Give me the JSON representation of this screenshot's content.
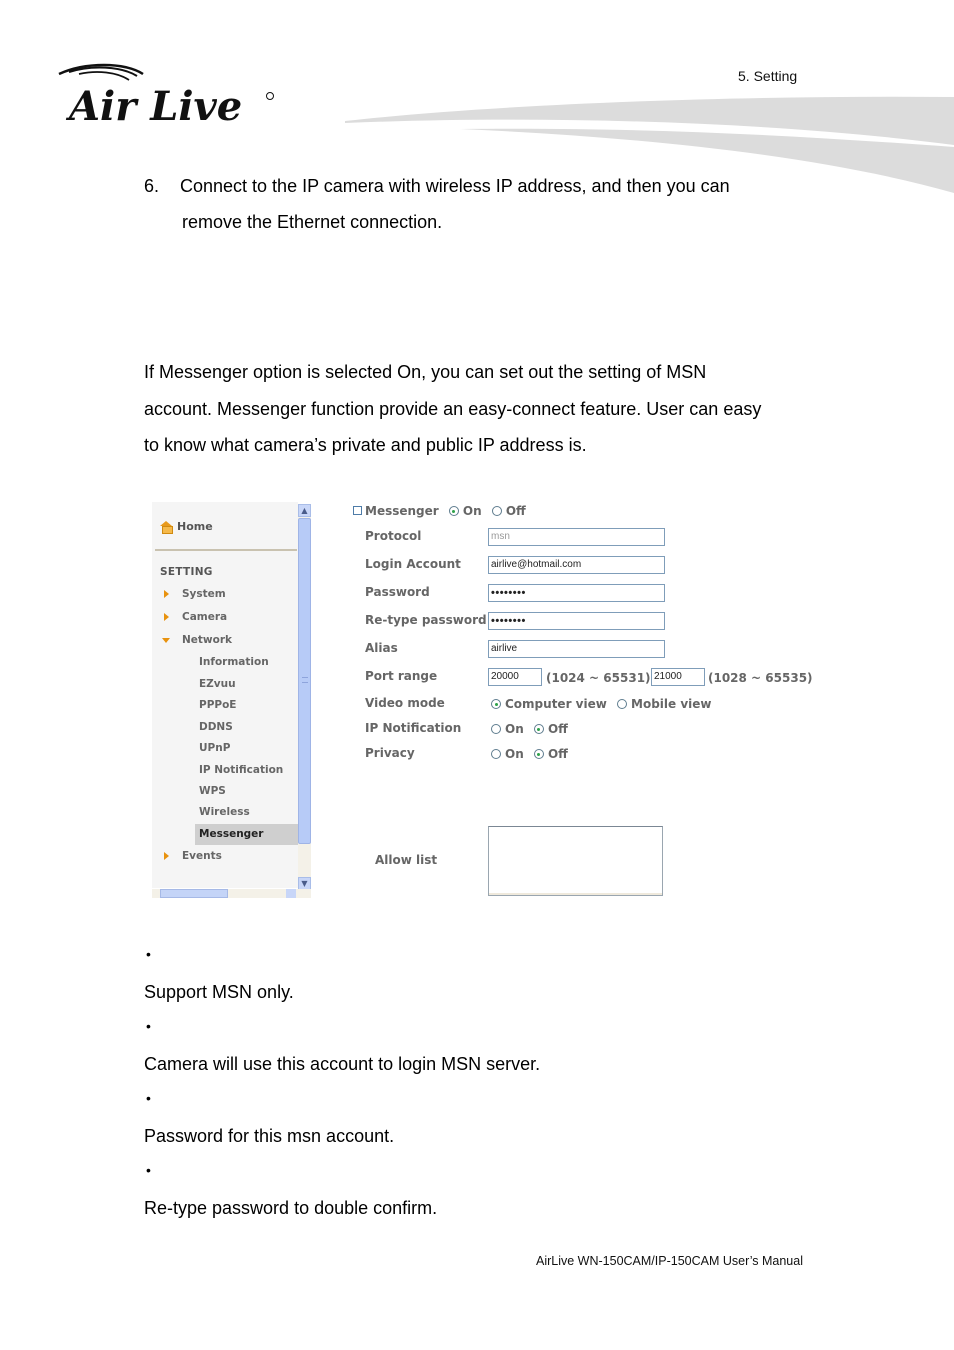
{
  "header": {
    "brand": "Air Live",
    "chapter": "5.  Setting"
  },
  "step": {
    "number": "6.",
    "line1": "Connect to the IP camera with wireless IP address, and then you can",
    "line2": "remove the Ethernet connection."
  },
  "intro": {
    "lines": [
      "If Messenger option is selected On, you can set out the setting of MSN",
      "account. Messenger function provide an easy-connect feature. User can easy",
      "to know what camera’s private and public IP address is."
    ]
  },
  "sidebar": {
    "home": "Home",
    "section": "SETTING",
    "items": [
      {
        "label": "System",
        "icon": "arrow-right-icon"
      },
      {
        "label": "Camera",
        "icon": "arrow-right-icon"
      },
      {
        "label": "Network",
        "icon": "arrow-down-icon"
      }
    ],
    "network_sub": [
      {
        "label": "Information"
      },
      {
        "label": "EZvuu"
      },
      {
        "label": "PPPoE"
      },
      {
        "label": "DDNS"
      },
      {
        "label": "UPnP"
      },
      {
        "label": "IP Notification"
      },
      {
        "label": "WPS"
      },
      {
        "label": "Wireless"
      },
      {
        "label": "Messenger",
        "active": true
      }
    ],
    "events": "Events"
  },
  "form": {
    "messenger": {
      "label": "Messenger",
      "on": "On",
      "off": "Off",
      "selected": "On"
    },
    "protocol": {
      "label": "Protocol",
      "value": "msn"
    },
    "login_account": {
      "label": "Login Account",
      "value": "airlive@hotmail.com"
    },
    "password": {
      "label": "Password",
      "value": "••••••••"
    },
    "retype_password": {
      "label": "Re-type password",
      "value": "••••••••"
    },
    "alias": {
      "label": "Alias",
      "value": "airlive"
    },
    "port_range": {
      "label": "Port range",
      "start": "20000",
      "start_range": "(1024 ~ 65531) ~",
      "end": "21000",
      "end_range": "(1028 ~ 65535)"
    },
    "video_mode": {
      "label": "Video mode",
      "options": [
        "Computer view",
        "Mobile view"
      ],
      "selected": "Computer view"
    },
    "ip_notification": {
      "label": "IP Notification",
      "on": "On",
      "off": "Off",
      "selected": "Off"
    },
    "privacy": {
      "label": "Privacy",
      "on": "On",
      "off": "Off",
      "selected": "Off"
    },
    "allow_list": {
      "label": "Allow list",
      "value": ""
    }
  },
  "bullets": [
    {
      "symbol": "•",
      "text": "Support MSN only."
    },
    {
      "symbol": "•",
      "text": "Camera will use this account to login MSN server."
    },
    {
      "symbol": "•",
      "text": "Password for this msn account."
    },
    {
      "symbol": "•",
      "text": "Re-type password to double confirm."
    }
  ],
  "footer": {
    "manual": "AirLive WN-150CAM/IP-150CAM User’s Manual"
  }
}
